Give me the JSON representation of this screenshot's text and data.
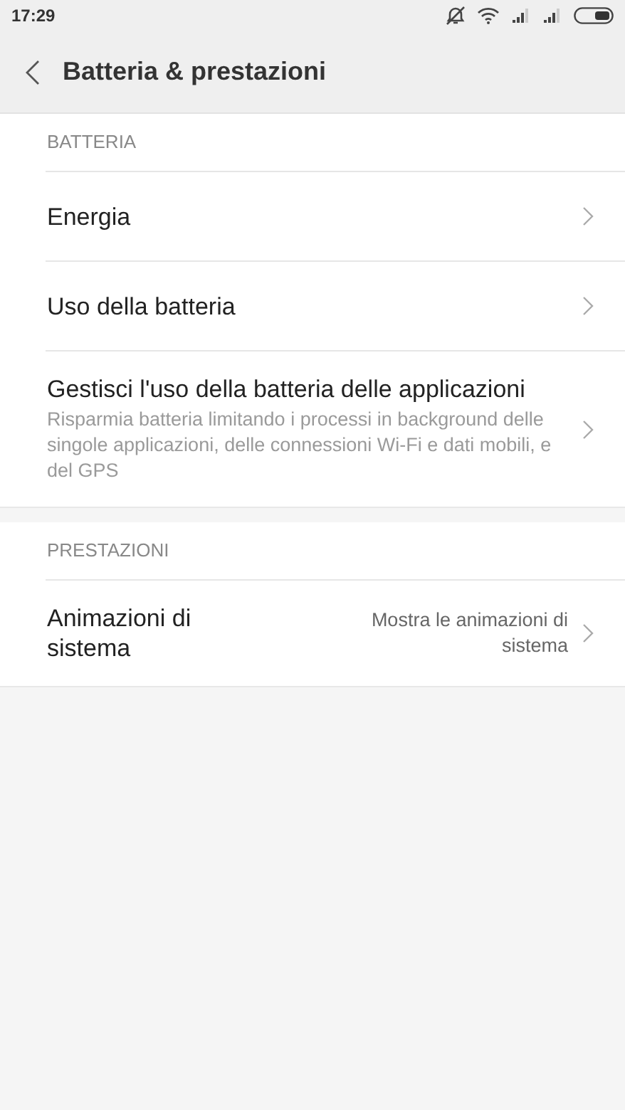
{
  "status_bar": {
    "time": "17:29"
  },
  "header": {
    "title": "Batteria & prestazioni"
  },
  "sections": [
    {
      "title": "BATTERIA",
      "items": [
        {
          "title": "Energia"
        },
        {
          "title": "Uso della batteria"
        },
        {
          "title": "Gestisci l'uso della batteria delle applicazioni",
          "description": "Risparmia batteria limitando i processi in background delle singole applicazioni, delle connessioni Wi-Fi e dati mobili, e del GPS"
        }
      ]
    },
    {
      "title": "PRESTAZIONI",
      "items": [
        {
          "title": "Animazioni di sistema",
          "value": "Mostra le animazioni di sistema"
        }
      ]
    }
  ]
}
